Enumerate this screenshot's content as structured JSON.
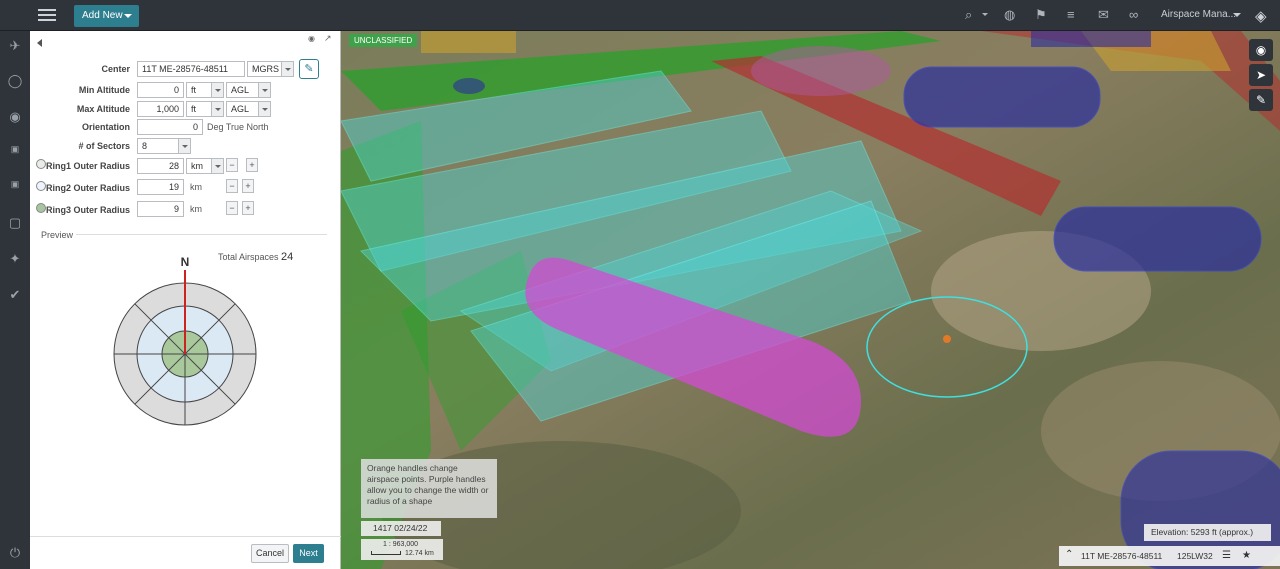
{
  "topbar": {
    "add_new_label": "Add New",
    "user_label": "Airspace Mana..."
  },
  "icons": {
    "search": "⌕",
    "globe": "◍",
    "flag": "⚑",
    "database": "≡",
    "mail": "✉",
    "link": "∞",
    "layers": "◈"
  },
  "panel": {
    "center_label": "Center",
    "center_value": "11T ME-28576-48511",
    "center_format": "MGRS",
    "min_alt_label": "Min Altitude",
    "min_alt_value": "0",
    "min_alt_unit": "ft",
    "min_alt_ref": "AGL",
    "max_alt_label": "Max Altitude",
    "max_alt_value": "1,000",
    "max_alt_unit": "ft",
    "max_alt_ref": "AGL",
    "orientation_label": "Orientation",
    "orientation_value": "0",
    "orientation_unit": "Deg True North",
    "sectors_label": "# of Sectors",
    "sectors_value": "8",
    "ring1_label": "Ring1 Outer Radius",
    "ring1_value": "28",
    "ring1_unit": "km",
    "ring2_label": "Ring2 Outer Radius",
    "ring2_value": "19",
    "ring2_unit": "km",
    "ring3_label": "Ring3 Outer Radius",
    "ring3_value": "9",
    "ring3_unit": "km",
    "minus": "−",
    "plus": "+",
    "preview_label": "Preview",
    "total_label": "Total Airspaces",
    "total_value": "24",
    "north_symbol": "N",
    "cancel_label": "Cancel",
    "next_label": "Next"
  },
  "map": {
    "classification": "UNCLASSIFIED",
    "hint": "Orange handles change airspace points. Purple handles allow you to change the width or radius of a shape",
    "date": "1417 02/24/22",
    "scale_ratio": "1 : 963,000",
    "scale_distance": "12.74 km",
    "elevation": "Elevation: 5293 ft (approx.)",
    "coord": "11T ME-28576-48511",
    "grid_ref": "125LW32"
  },
  "colors": {
    "accent": "#2d7e8f",
    "ring1_radio": "#a9c4a0",
    "ring_green": "#a9c99d",
    "ring_blue": "#dbe9f5",
    "ring_grey": "#dcdcdc",
    "north_line": "#cc2222"
  }
}
